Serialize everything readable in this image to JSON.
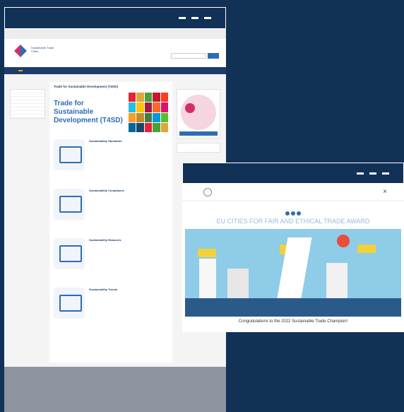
{
  "window_a": {
    "controls": [
      "—",
      "—",
      "—"
    ],
    "page": {
      "topbar": [
        "",
        "",
        ""
      ],
      "logo_text": "Sustainable Trade Cities",
      "nav": [
        "",
        "",
        "",
        "",
        "",
        "",
        ""
      ],
      "breadcrumb": "",
      "left_nav": [
        "",
        "",
        "",
        "",
        "",
        "",
        "",
        ""
      ],
      "main_title": "Trade for Sustainable Development (T4SD)",
      "hero_text": "Trade for Sustainable Development (T4SD)",
      "para1": "",
      "para2": "",
      "items": [
        {
          "title": "Sustainability Standards",
          "text": ""
        },
        {
          "title": "Sustainability Compliance",
          "text": ""
        },
        {
          "title": "Sustainability Measures",
          "text": ""
        },
        {
          "title": "Sustainability Trends",
          "text": ""
        }
      ],
      "side": {
        "box1_label": "",
        "button": "",
        "box2_lines": [
          "",
          "",
          ""
        ]
      },
      "footer_columns": [
        "",
        "",
        "",
        "",
        "",
        ""
      ]
    }
  },
  "window_b": {
    "controls": [
      "—",
      "—",
      "—"
    ],
    "page": {
      "nav": [
        "",
        "",
        "",
        "",
        "",
        ""
      ],
      "award_title": "EU CITIES FOR FAIR AND ETHICAL TRADE AWARD",
      "congrats": "Congratulations to the 2022 Sustainable Trade Champion!"
    }
  },
  "colors": {
    "background": "#123156",
    "brand_blue": "#2d6db5",
    "award_title": "#9db8d9",
    "sun": "#ea4d3b"
  }
}
